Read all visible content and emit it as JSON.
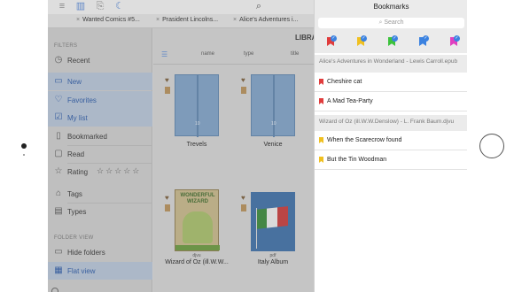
{
  "tabs": [
    {
      "label": "Wanted Comics #5..."
    },
    {
      "label": "Prasident Lincolns..."
    },
    {
      "label": "Alice's Adventures i..."
    }
  ],
  "sidebar": {
    "filters_label": "FILTERS",
    "folder_view_label": "FOLDER VIEW",
    "items": [
      {
        "label": "Recent",
        "icon": "clock-icon",
        "selected": false
      },
      {
        "label": "New",
        "icon": "new-icon",
        "selected": true
      },
      {
        "label": "Favorites",
        "icon": "heart-icon",
        "selected": true
      },
      {
        "label": "My list",
        "icon": "checkbox-icon",
        "selected": true
      },
      {
        "label": "Bookmarked",
        "icon": "bookmark-icon",
        "selected": false
      },
      {
        "label": "Read",
        "icon": "read-icon",
        "selected": false
      },
      {
        "label": "Rating",
        "icon": "star-icon",
        "selected": false
      },
      {
        "label": "Tags",
        "icon": "tag-icon",
        "selected": false
      },
      {
        "label": "Types",
        "icon": "document-icon",
        "selected": false
      },
      {
        "label": "Hide folders",
        "icon": "folder-icon",
        "selected": false
      },
      {
        "label": "Flat view",
        "icon": "flat-view-icon",
        "selected": true
      }
    ],
    "rating_stars": "☆☆☆☆☆"
  },
  "main": {
    "title": "LIBRA",
    "columns": [
      "name",
      "type",
      "title"
    ],
    "books": [
      {
        "caption": "Trevels",
        "number": "10"
      },
      {
        "caption": "Venice",
        "number": "10"
      },
      {
        "caption": "Wizard of Oz (ill.W.W...",
        "sub": "djvu"
      },
      {
        "caption": "Italy Album",
        "sub": "pdf"
      }
    ],
    "cover_art": {
      "wizard_title": "WONDERFUL WIZARD"
    }
  },
  "bookmarks": {
    "title": "Bookmarks",
    "search_placeholder": "Search",
    "colors": [
      "#e03c3c",
      "#f0c020",
      "#3cc23c",
      "#3b82e0",
      "#e040c0"
    ],
    "groups": [
      {
        "header": "Alice's Adventures in Wonderland - Lewis Carroll.epub",
        "items": [
          {
            "label": "Cheshire cat",
            "color": "#e03c3c"
          },
          {
            "label": "A Mad Tea-Party",
            "color": "#e03c3c"
          }
        ]
      },
      {
        "header": "Wizard of Oz (ill.W.W.Denslow) - L. Frank Baum.djvu",
        "items": [
          {
            "label": "When the Scarecrow found",
            "color": "#f0c020"
          },
          {
            "label": "But the Tin Woodman",
            "color": "#f0c020"
          }
        ]
      }
    ]
  }
}
